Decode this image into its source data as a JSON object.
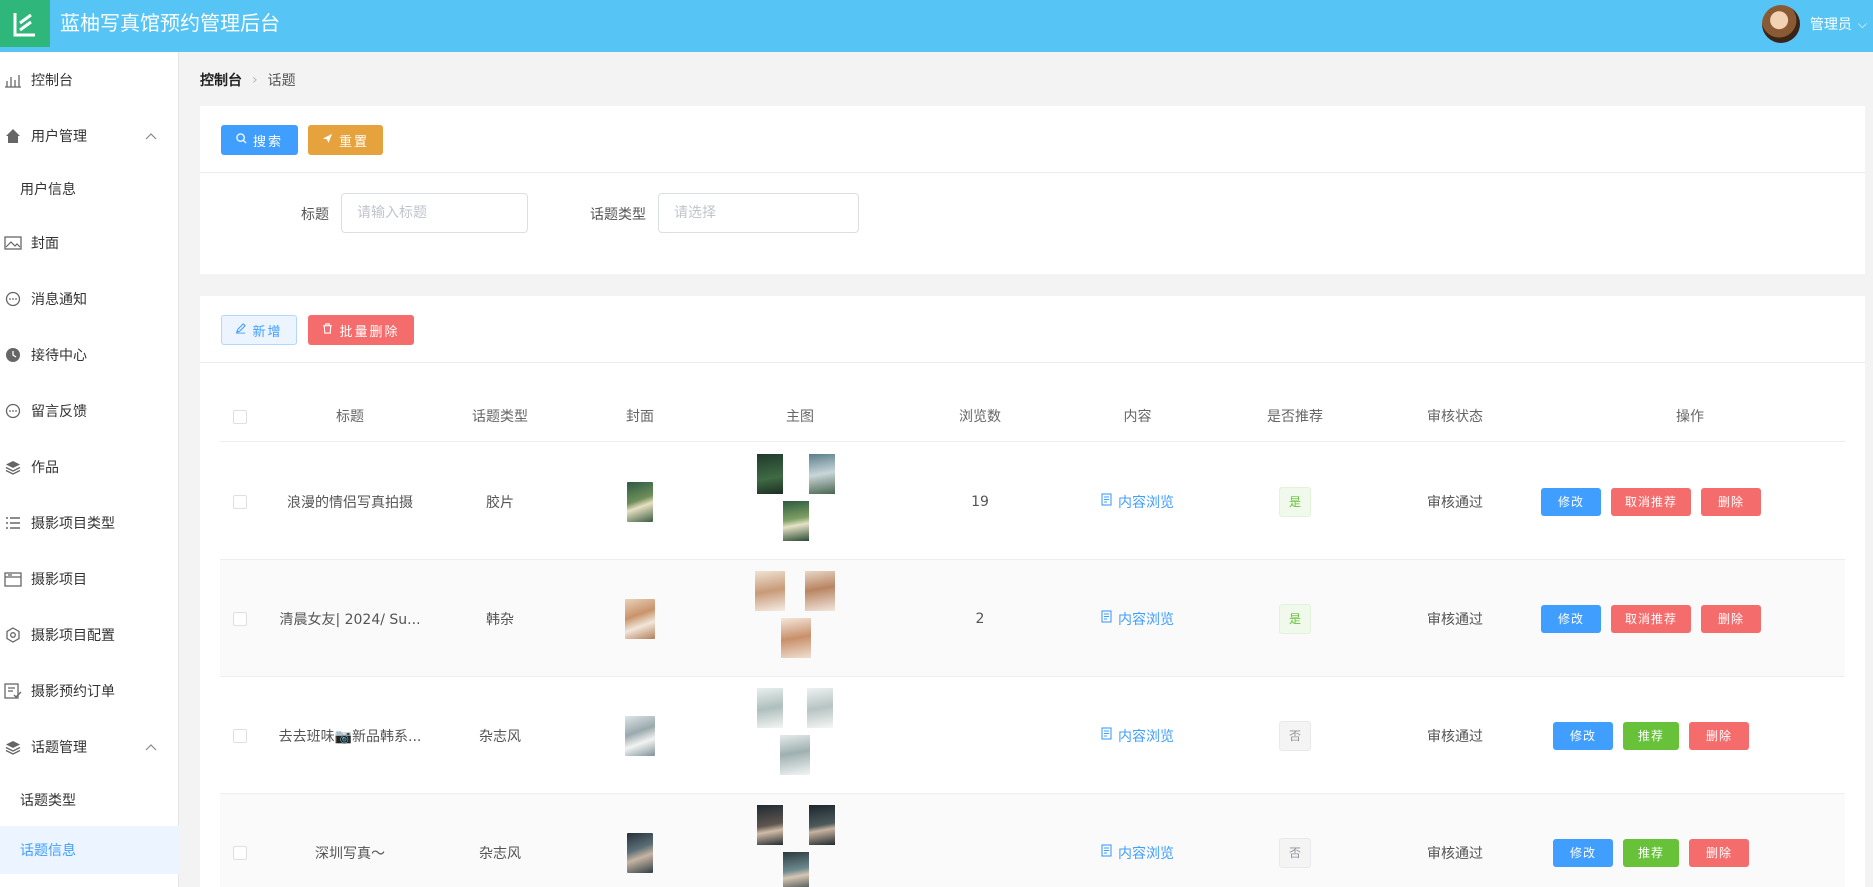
{
  "header": {
    "title": "蓝柚写真馆预约管理后台",
    "user": "管理员",
    "colors": {
      "bar": "#56c5f5",
      "logo": "#2fb67a"
    }
  },
  "sidebar": {
    "items": [
      {
        "label": "控制台",
        "icon": "chart-icon"
      },
      {
        "label": "用户管理",
        "icon": "home-icon",
        "expanded": true
      },
      {
        "label": "用户信息",
        "sub": true
      },
      {
        "label": "封面",
        "icon": "image-icon"
      },
      {
        "label": "消息通知",
        "icon": "chat-icon"
      },
      {
        "label": "接待中心",
        "icon": "clock-icon"
      },
      {
        "label": "留言反馈",
        "icon": "chat-icon"
      },
      {
        "label": "作品",
        "icon": "layers-icon"
      },
      {
        "label": "摄影项目类型",
        "icon": "list-icon"
      },
      {
        "label": "摄影项目",
        "icon": "folder-icon"
      },
      {
        "label": "摄影项目配置",
        "icon": "gear-icon"
      },
      {
        "label": "摄影预约订单",
        "icon": "order-icon"
      },
      {
        "label": "话题管理",
        "icon": "layers-icon",
        "expanded": true
      },
      {
        "label": "话题类型",
        "sub": true
      },
      {
        "label": "话题信息",
        "sub": true,
        "active": true
      }
    ]
  },
  "breadcrumb": {
    "home": "控制台",
    "current": "话题"
  },
  "search": {
    "search_btn": "搜索",
    "reset_btn": "重置",
    "title_label": "标题",
    "title_placeholder": "请输入标题",
    "type_label": "话题类型",
    "type_placeholder": "请选择"
  },
  "toolbar": {
    "add_btn": "新增",
    "batch_delete_btn": "批量删除"
  },
  "table": {
    "columns": [
      "标题",
      "话题类型",
      "封面",
      "主图",
      "浏览数",
      "内容",
      "是否推荐",
      "审核状态",
      "操作"
    ],
    "rows": [
      {
        "title": "浪漫的情侣写真拍摄",
        "type": "胶片",
        "views": "19",
        "content": "内容浏览",
        "recommended": "是",
        "rec_yes": true,
        "status": "审核通过",
        "btn_edit": "修改",
        "btn_rec": "取消推荐",
        "btn_delete": "删除"
      },
      {
        "title": "清晨女友| 2024/ Su...",
        "type": "韩杂",
        "views": "2",
        "content": "内容浏览",
        "recommended": "是",
        "rec_yes": true,
        "status": "审核通过",
        "btn_edit": "修改",
        "btn_rec": "取消推荐",
        "btn_delete": "删除"
      },
      {
        "title": "去去班味📷新品韩系...",
        "type": "杂志风",
        "views": "",
        "content": "内容浏览",
        "recommended": "否",
        "rec_yes": false,
        "status": "审核通过",
        "btn_edit": "修改",
        "btn_rec": "推荐",
        "btn_delete": "删除"
      },
      {
        "title": "深圳写真～",
        "type": "杂志风",
        "views": "",
        "content": "内容浏览",
        "recommended": "否",
        "rec_yes": false,
        "status": "审核通过",
        "btn_edit": "修改",
        "btn_rec": "推荐",
        "btn_delete": "删除"
      }
    ]
  }
}
